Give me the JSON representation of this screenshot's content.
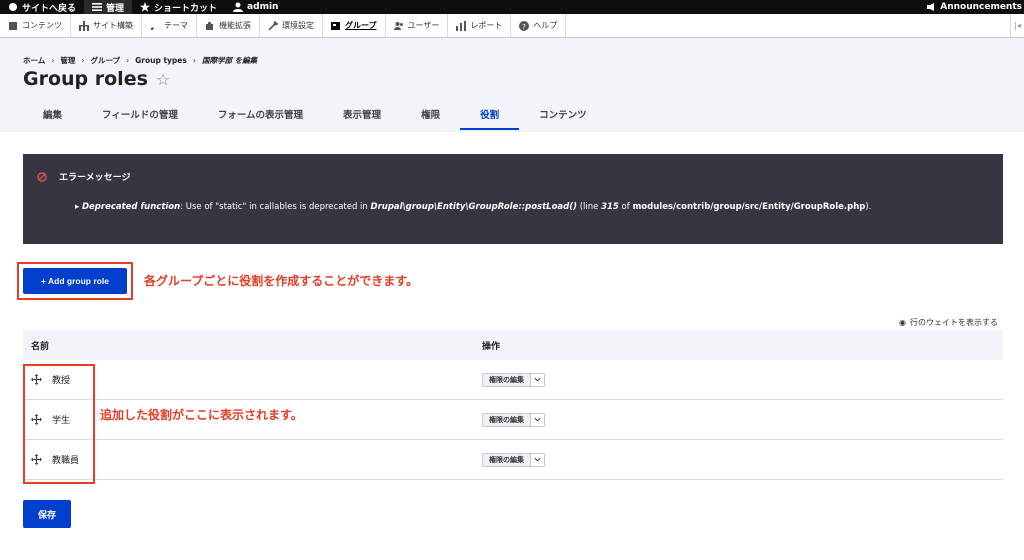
{
  "toolbar": {
    "back": "サイトへ戻る",
    "manage": "管理",
    "shortcuts": "ショートカット",
    "user": "admin",
    "announcements": "Announcements"
  },
  "tray": {
    "items": [
      "コンテンツ",
      "サイト構築",
      "テーマ",
      "機能拡張",
      "環境設定",
      "グループ",
      "ユーザー",
      "レポート",
      "ヘルプ"
    ]
  },
  "breadcrumb": [
    "ホーム",
    "管理",
    "グループ",
    "Group types",
    "国際学部 を編集"
  ],
  "page": {
    "title": "Group roles"
  },
  "tabs": [
    "編集",
    "フィールドの管理",
    "フォームの表示管理",
    "表示管理",
    "権限",
    "役割",
    "コンテンツ"
  ],
  "error": {
    "heading": "エラーメッセージ",
    "label": "Deprecated function",
    "text1": ": Use of \"static\" in callables is deprecated in ",
    "func": "Drupal\\group\\Entity\\GroupRole::postLoad()",
    "text2": " (line ",
    "line": "315",
    "text3": " of ",
    "file": "modules/contrib/group/src/Entity/GroupRole.php",
    "text4": ")."
  },
  "actions": {
    "add_label": "+ Add group role",
    "save_label": "保存"
  },
  "annotations": {
    "note1": "各グループごとに役割を作成することができます。",
    "note2": "追加した役割がここに表示されます。"
  },
  "table": {
    "show_weights": "行のウェイトを表示する",
    "headers": [
      "名前",
      "操作"
    ],
    "rows": [
      {
        "name": "教授",
        "op": "権限の編集"
      },
      {
        "name": "学生",
        "op": "権限の編集"
      },
      {
        "name": "教職員",
        "op": "権限の編集"
      }
    ]
  },
  "colors": {
    "primary": "#003ecc",
    "annotation": "#e53d25",
    "error_bg": "#353641"
  }
}
